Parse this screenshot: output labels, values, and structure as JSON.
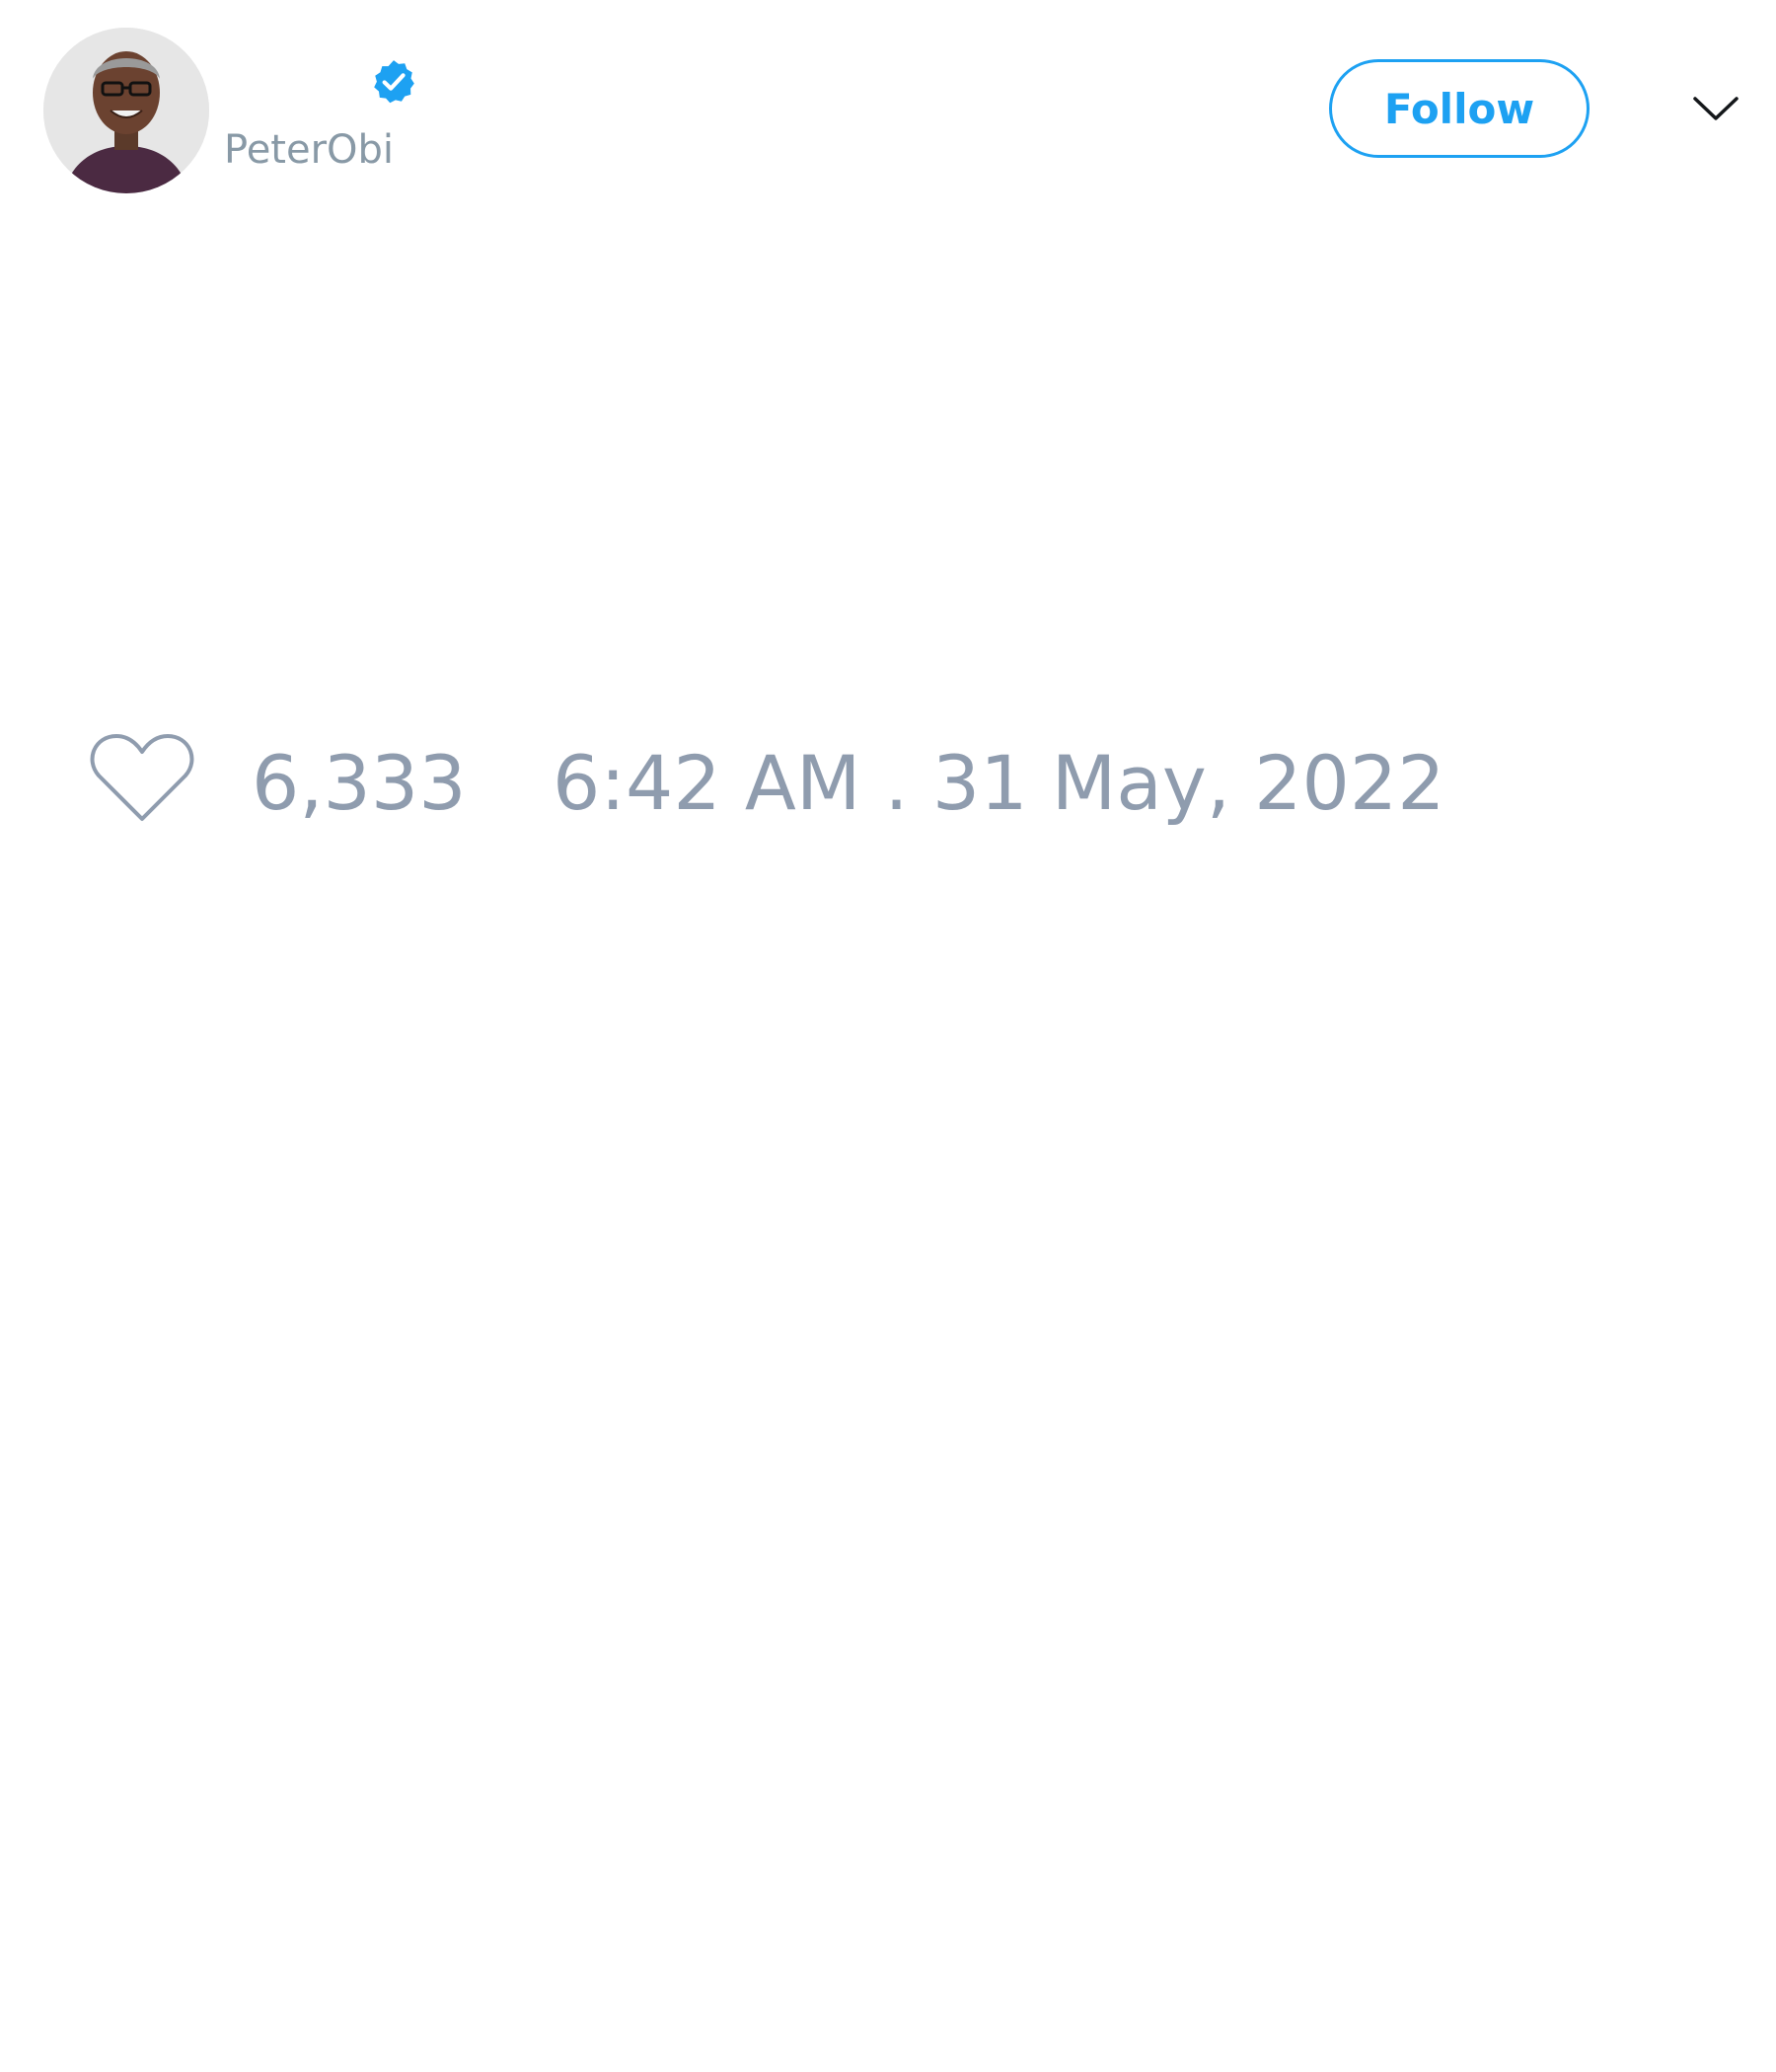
{
  "tweet": {
    "author": {
      "handle": "PeterObi",
      "avatar_icon": "profile-photo",
      "verified_icon": "verified-badge-icon",
      "verified_color": "#1da1f2"
    },
    "follow_label": "Follow",
    "menu_icon": "chevron-down-icon",
    "likes": {
      "icon": "heart-icon",
      "count": "6,333"
    },
    "timestamp": "6:42 AM . 31 May, 2022"
  },
  "colors": {
    "accent": "#1da1f2",
    "muted_text": "#8f9cae",
    "background": "#ffffff"
  }
}
